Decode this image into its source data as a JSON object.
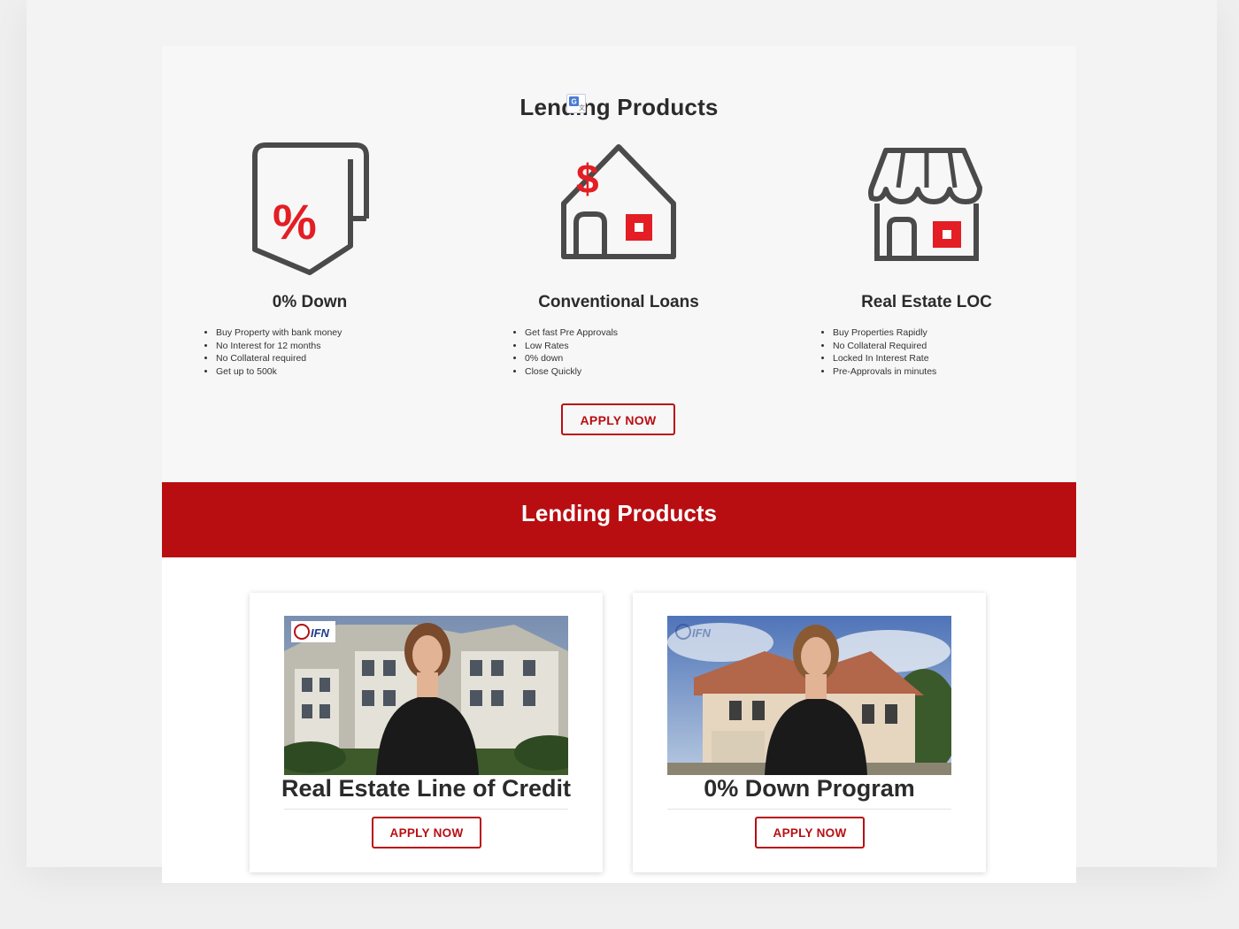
{
  "section_top": {
    "title": "Lending Products",
    "products": [
      {
        "icon": "percent-tag-icon",
        "name": "0% Down",
        "features": [
          "Buy Property with bank money",
          "No Interest for 12 months",
          "No Collateral required",
          "Get up to 500k"
        ]
      },
      {
        "icon": "house-dollar-icon",
        "name": "Conventional Loans",
        "features": [
          "Get fast Pre Approvals",
          "Low Rates",
          "0% down",
          "Close Quickly"
        ]
      },
      {
        "icon": "storefront-icon",
        "name": "Real Estate LOC",
        "features": [
          "Buy Properties Rapidly",
          "No Collateral Required",
          "Locked In Interest Rate",
          "Pre-Approvals in minutes"
        ]
      }
    ],
    "apply_label": "APPLY NOW"
  },
  "banner": {
    "title": "Lending Products"
  },
  "cards": [
    {
      "title": "Real Estate Line of Credit",
      "apply_label": "APPLY NOW",
      "logo_text": "IFN",
      "thumbnail": "video-thumbnail-apartment"
    },
    {
      "title": "0% Down Program",
      "apply_label": "APPLY NOW",
      "logo_text": "IFN",
      "thumbnail": "video-thumbnail-house"
    }
  ],
  "colors": {
    "brand_red": "#b80e12",
    "icon_red": "#e31e24",
    "icon_gray": "#4a4a4a"
  }
}
